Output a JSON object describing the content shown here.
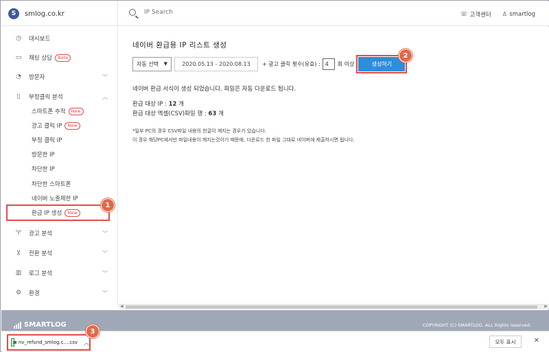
{
  "brand": {
    "logo_letter": "S",
    "name": "smlog.co.kr"
  },
  "search": {
    "placeholder": "IP Search"
  },
  "top_links": {
    "support": "고객센터",
    "user": "smartlog"
  },
  "sidebar": {
    "items": [
      {
        "label": "대시보드",
        "icon": "dashboard-icon"
      },
      {
        "label": "채팅 상담",
        "icon": "chat-icon",
        "badge": "Beta"
      },
      {
        "label": "방문자",
        "icon": "visitor-icon"
      },
      {
        "label": "부정클릭 분석",
        "icon": "fraud-click-icon"
      }
    ],
    "sub_items": [
      {
        "label": "스마트폰 추적",
        "badge": "New"
      },
      {
        "label": "광고 클릭 IP",
        "badge": "New"
      },
      {
        "label": "부정 클릭 IP"
      },
      {
        "label": "방문한 IP"
      },
      {
        "label": "차단한 IP"
      },
      {
        "label": "차단한 스마트폰"
      },
      {
        "label": "네이버 노출제한 IP"
      },
      {
        "label": "환급 IP 생성",
        "badge": "New"
      }
    ],
    "lower_items": [
      {
        "label": "광고 분석",
        "icon": "trophy-icon"
      },
      {
        "label": "전환 분석",
        "icon": "cart-icon"
      },
      {
        "label": "로그 분석",
        "icon": "log-icon"
      },
      {
        "label": "환경",
        "icon": "gear-icon"
      }
    ]
  },
  "main": {
    "title": "네이버 환급용 IP 리스트 생성",
    "select_value": "자동 선택",
    "date_range": "2020.05.13 - 2020.08.13",
    "click_label": "+ 광고 클릭 횟수(유효) :",
    "click_value": "4",
    "after_label": "회 이상",
    "generate_label": "생성하기",
    "result_msg": "네이버 환급 서식이 생성 되었습니다. 파일은 자동 다운로드 됩니다.",
    "stat1_label": "환급 대상 IP :",
    "stat1_value": "12",
    "stat1_unit": "개",
    "stat2_label": "환급 대상 엑셀(CSV)파일 행 :",
    "stat2_value": "63",
    "stat2_unit": "개",
    "note1": "*일부 PC의 경우 CSV파일 내용의 한글이 깨지는 경우가 있습니다.",
    "note2": "이 경우 해당PC에서만 파일내용이 깨지는것이기 때문에, 다운로드 한 파일 그대로 네이버에 제출하시면 됩니다."
  },
  "footer": {
    "logo": "SMARTLOG",
    "copyright": "COPYRIGHT (C) SMARTLOG. ALL Rights reserved."
  },
  "download": {
    "filename": "nv_refund_smlog.c....csv",
    "show_all": "모두 표시",
    "close": "✕"
  },
  "markers": {
    "m1": "1",
    "m2": "2",
    "m3": "3"
  },
  "colors": {
    "accent": "#2e8ed9",
    "marker": "#e06a4a",
    "highlight": "#e24a4a",
    "footer": "#a0a8b8"
  }
}
